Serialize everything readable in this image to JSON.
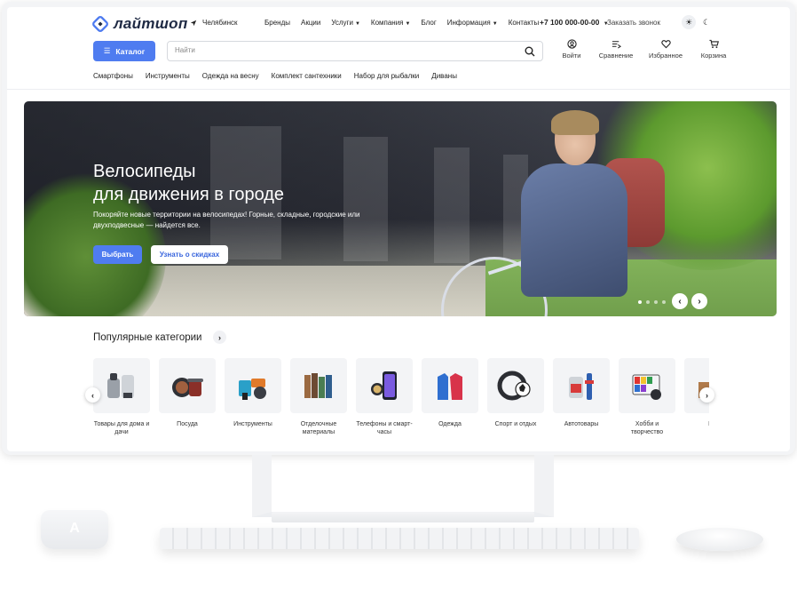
{
  "brand": {
    "name": "лайтшоп",
    "accent": "#4f7cf0"
  },
  "header": {
    "city": "Челябинск",
    "nav": [
      {
        "label": "Бренды",
        "dropdown": false
      },
      {
        "label": "Акции",
        "dropdown": false
      },
      {
        "label": "Услуги",
        "dropdown": true
      },
      {
        "label": "Компания",
        "dropdown": true
      },
      {
        "label": "Блог",
        "dropdown": false
      },
      {
        "label": "Информация",
        "dropdown": true
      },
      {
        "label": "Контакты",
        "dropdown": false
      }
    ],
    "phone": "+7 100 000-00-00",
    "callback": "Заказать звонок",
    "catalog_label": "Каталог",
    "search_placeholder": "Найти",
    "actions": [
      {
        "label": "Войти",
        "icon": "user-icon"
      },
      {
        "label": "Сравнение",
        "icon": "compare-icon"
      },
      {
        "label": "Избранное",
        "icon": "heart-icon"
      },
      {
        "label": "Корзина",
        "icon": "cart-icon"
      }
    ],
    "quick_links": [
      "Смартфоны",
      "Инструменты",
      "Одежда на весну",
      "Комплект сантехники",
      "Набор для рыбалки",
      "Диваны"
    ]
  },
  "banner": {
    "title_line1": "Велосипеды",
    "title_line2": "для движения в городе",
    "text": "Покоряйте новые территории на велосипедах! Горные, складные, городские или двухподвесные — найдется все.",
    "primary_button": "Выбрать",
    "secondary_button": "Узнать о скидках",
    "slides_count": 4,
    "active_slide": 1
  },
  "categories": {
    "title": "Популярные категории",
    "items": [
      {
        "label": "Товары для дома и дачи"
      },
      {
        "label": "Посуда"
      },
      {
        "label": "Инструменты"
      },
      {
        "label": "Отделочные материалы"
      },
      {
        "label": "Телефоны и смарт-часы"
      },
      {
        "label": "Одежда"
      },
      {
        "label": "Спорт и отдых"
      },
      {
        "label": "Автотовары"
      },
      {
        "label": "Хобби и творчество"
      },
      {
        "label": "Ме"
      }
    ]
  },
  "desk": {
    "speaker_letter": "A"
  }
}
